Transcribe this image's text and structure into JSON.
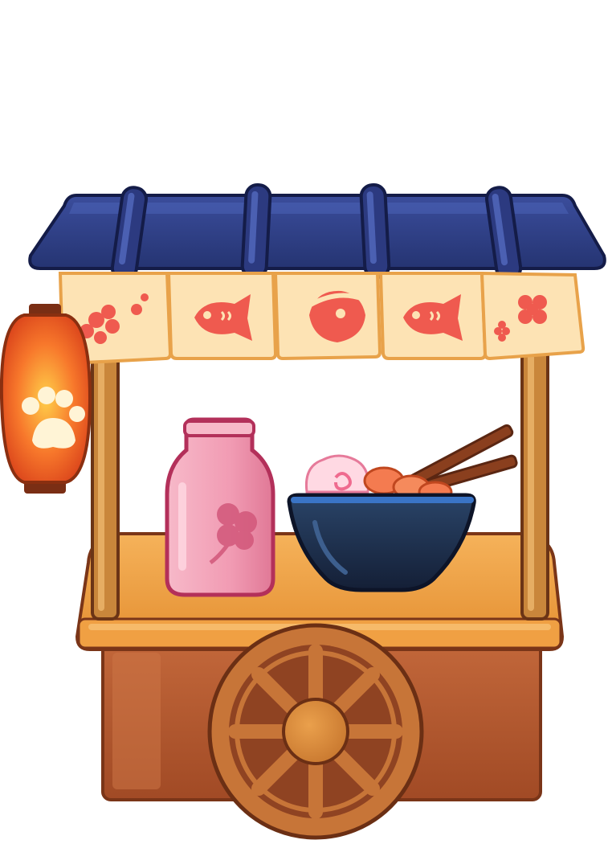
{
  "scene": {
    "subject": "food-cart",
    "style": "cartoon-game-asset"
  },
  "colors": {
    "background": "#ffffff",
    "roof": "#2f3f86",
    "roof_highlight": "#3f55a8",
    "roof_dark": "#202a5e",
    "noren": "#fde3b4",
    "noren_border": "#e8a24a",
    "noren_motif": "#ef5a4f",
    "post": "#c9863b",
    "counter_top": "#f3a34a",
    "counter_edge": "#e08a2c",
    "cart_body": "#b65a2e",
    "cart_body_dark": "#8f4322",
    "wheel": "#c77538",
    "wheel_hub": "#d48235",
    "lantern": "#f0651f",
    "lantern_glow": "#ffd25a",
    "bottle": "#f4a3b8",
    "bottle_dark": "#d2577a",
    "bowl": "#1d2d4a",
    "bowl_rim": "#3a74c6",
    "chopsticks": "#7a3a20",
    "naruto": "#ffd9e3",
    "shrimp": "#f47b50"
  },
  "noren_panels": [
    {
      "icon": "cherry-blossom-icon"
    },
    {
      "icon": "taiyaki-fish-icon"
    },
    {
      "icon": "fish-bandana-icon"
    },
    {
      "icon": "taiyaki-fish-icon"
    },
    {
      "icon": "flower-icon"
    }
  ],
  "items": {
    "lantern": {
      "icon": "paw-print-icon"
    },
    "bottle": {
      "icon": "sake-bottle-icon"
    },
    "bowl": {
      "icon": "ramen-bowl-icon"
    },
    "wheel": {
      "icon": "cart-wheel-icon"
    }
  }
}
